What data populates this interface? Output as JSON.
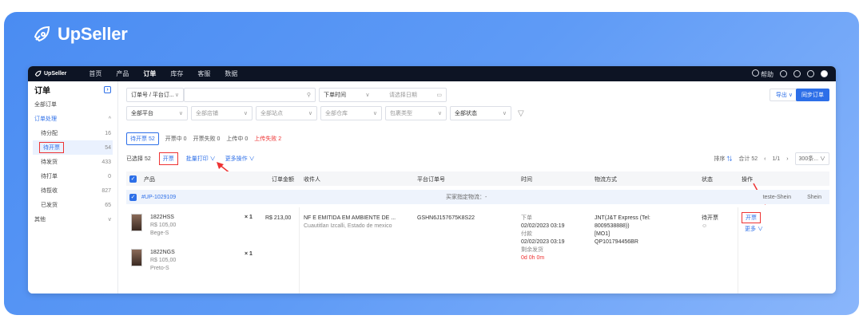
{
  "brand": {
    "name": "UpSeller"
  },
  "topnav": {
    "logo": "UpSeller",
    "items": [
      "首页",
      "产品",
      "订单",
      "库存",
      "客服",
      "数据"
    ],
    "right_help": "帮助"
  },
  "sidebar": {
    "title": "订单",
    "items": [
      {
        "label": "全部订单",
        "count": ""
      },
      {
        "label": "订单处理",
        "count": "^"
      },
      {
        "label": "待分配",
        "count": "16"
      },
      {
        "label": "待开票",
        "count": "54"
      },
      {
        "label": "待发货",
        "count": "433"
      },
      {
        "label": "待打单",
        "count": "0"
      },
      {
        "label": "待揽收",
        "count": "827"
      },
      {
        "label": "已发货",
        "count": "65"
      },
      {
        "label": "其他",
        "count": "v"
      }
    ]
  },
  "filters": {
    "order_no": "订单号 / 平台订...",
    "search_icon": "search-icon",
    "time_type": "下单时间",
    "date_placeholder": "请选择日期",
    "platform": "全部平台",
    "shop": "全部店铺",
    "site": "全部站点",
    "warehouse": "全部仓库",
    "logistics": "包裹类型",
    "status": "全部状态"
  },
  "top_buttons": {
    "export": "导出",
    "sync": "同步订单"
  },
  "tabs": [
    {
      "label": "待开票 52",
      "active": true
    },
    {
      "label": "开票中 0"
    },
    {
      "label": "开票失败 0"
    },
    {
      "label": "上传中 0"
    },
    {
      "label": "上传失败 2"
    }
  ],
  "actions": {
    "selected": "已选择 52",
    "invoice": "开票",
    "batch_print": "批量打印",
    "more_ops": "更多操作",
    "sort": "排序",
    "total": "合计 52",
    "page": "1/1",
    "per_page": "300条..."
  },
  "table_headers": [
    "产品",
    "订单金额",
    "收件人",
    "平台订单号",
    "时间",
    "物流方式",
    "状态",
    "操作"
  ],
  "group": {
    "id": "#UP-1029109",
    "note": "买家指定物流：-",
    "shop": "teste-Shein",
    "platform": "Shein"
  },
  "order": {
    "items": [
      {
        "sku": "1822HSS",
        "price": "R$ 105,00",
        "variant": "Bege-S",
        "qty": "× 1"
      },
      {
        "sku": "1822NGS",
        "price": "R$ 105,00",
        "variant": "Preto-S",
        "qty": "× 1"
      }
    ],
    "amount": "R$ 213,00",
    "recipient_line1": "NF E EMITIDA EM AMBIENTE DE ...",
    "recipient_line2": "Cuautitlan Izcalli, Estado de mexico",
    "platform_order": "GSHN6J157675K8S22",
    "time_l1": "下单",
    "time_v1": "02/02/2023 03:19",
    "time_l2": "付款",
    "time_v2": "02/02/2023 03:19",
    "time_l3": "剩余发货",
    "time_v3": "0d 0h 0m",
    "logistics_l1": "JNT(J&T Express (Tel:",
    "logistics_l2": "8009538888))",
    "logistics_l3": "[MO1]",
    "logistics_l4": "QP101794456BR",
    "status": "待开票",
    "op": "开票",
    "op_more": "更多"
  },
  "colors": {
    "accent": "#2d6fe8",
    "highlight": "#e33333",
    "nav": "#0d1424"
  }
}
